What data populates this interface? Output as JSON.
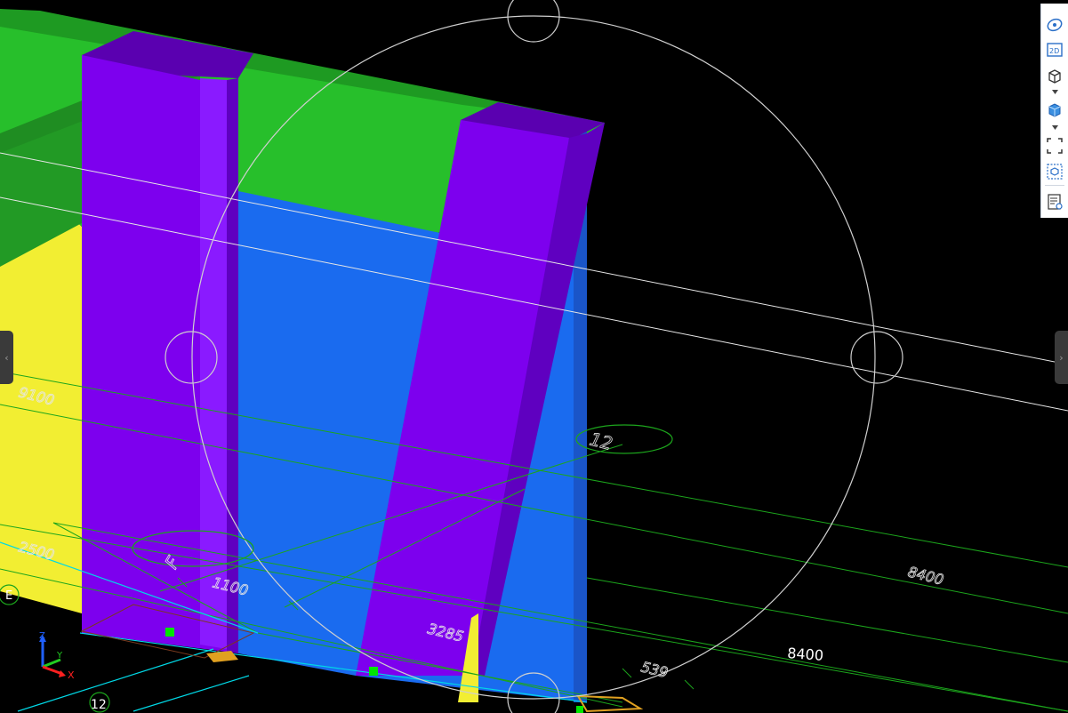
{
  "viewport": {
    "labels": {
      "dim_9100": "9100",
      "dim_2500": "2500",
      "dim_1100": "1100",
      "dim_3285": "3285",
      "dim_8400_upper": "8400",
      "dim_8400_lower": "8400",
      "dim_539": "539",
      "grid_12_center": "12",
      "grid_f": "F",
      "grid_12_bottom": "12",
      "grid_e": "E"
    },
    "colors": {
      "background": "#000000",
      "green_beam": "#27bf2b",
      "purple_column": "#7d00ee",
      "blue_slab": "#1a6bef",
      "yellow_wall": "#f2ee32",
      "gridline": "#1ca51c",
      "cyan_line": "#00d8e6",
      "white_line": "#e6e6e6",
      "snap_point": "#00e600"
    }
  },
  "axis_triad": {
    "z_label": "Z",
    "y_label": "Y",
    "x_label": "X"
  },
  "toolbar": {
    "view_2d_label": "2D",
    "buttons": [
      "orbit-icon",
      "view-2d-icon",
      "view-3d-cube-icon",
      "render-mode-cube-icon",
      "zoom-extents-icon",
      "model-box-icon",
      "properties-list-icon"
    ]
  },
  "side_tabs": {
    "left_glyph": "‹",
    "right_glyph": "›"
  }
}
